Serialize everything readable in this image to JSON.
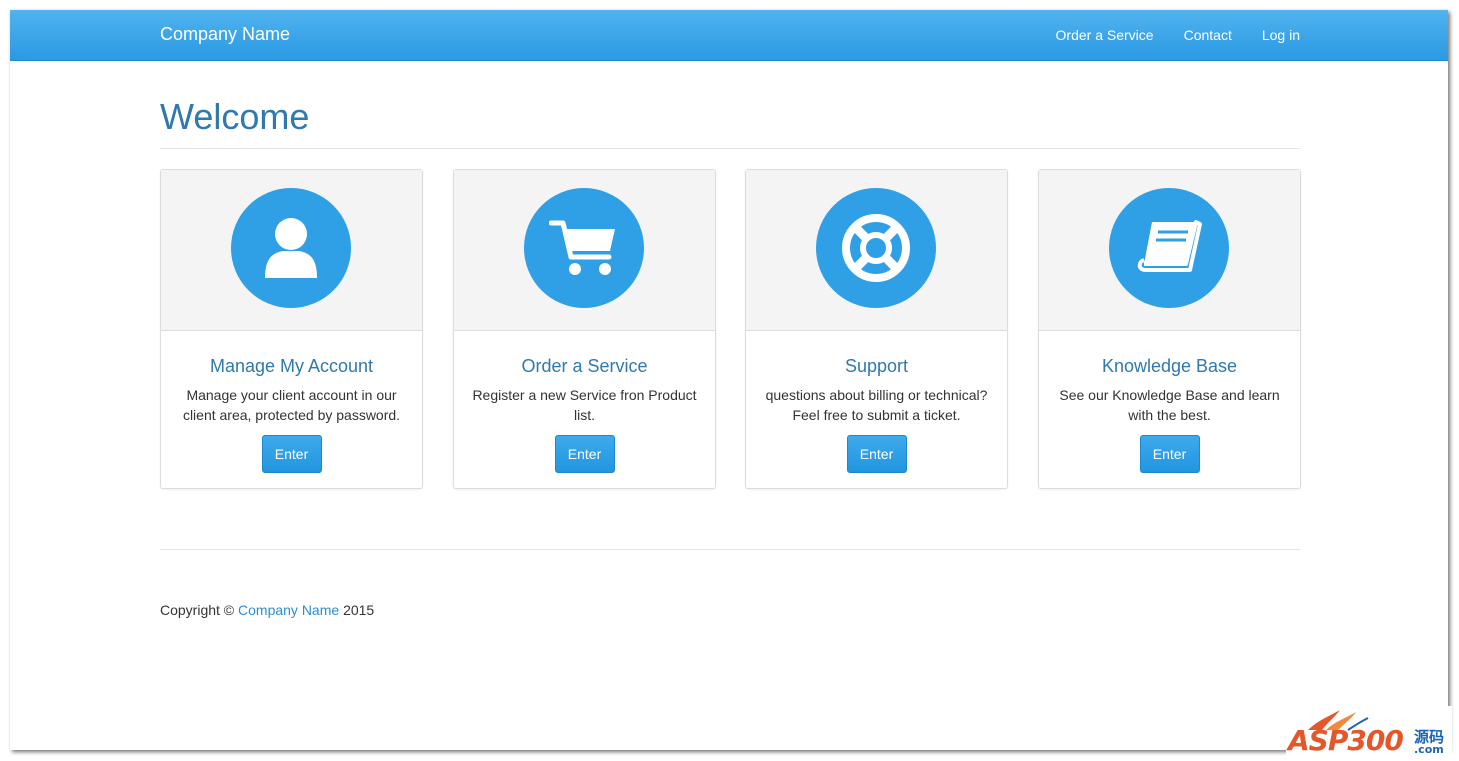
{
  "navbar": {
    "brand": "Company Name",
    "links": [
      "Order a Service",
      "Contact",
      "Log in"
    ]
  },
  "page": {
    "title": "Welcome"
  },
  "cards": [
    {
      "icon": "user-icon",
      "title": "Manage My Account",
      "text": "Manage your client account in our client area, protected by password.",
      "button": "Enter"
    },
    {
      "icon": "shopping-cart-icon",
      "title": "Order a Service",
      "text": "Register a new Service fron Product list.",
      "button": "Enter"
    },
    {
      "icon": "life-ring-icon",
      "title": "Support",
      "text": "questions about billing or technical? Feel free to submit a ticket.",
      "button": "Enter"
    },
    {
      "icon": "book-icon",
      "title": "Knowledge Base",
      "text": "See our Knowledge Base and learn with the best.",
      "button": "Enter"
    }
  ],
  "footer": {
    "prefix": "Copyright ©",
    "company": "Company Name",
    "year": "2015"
  },
  "watermark": {
    "text": "ASP300",
    "cn": "源码",
    "domain": ".com"
  },
  "colors": {
    "primary": "#2f9fe6",
    "heading": "#2f79ad",
    "link": "#2a8fd3"
  }
}
